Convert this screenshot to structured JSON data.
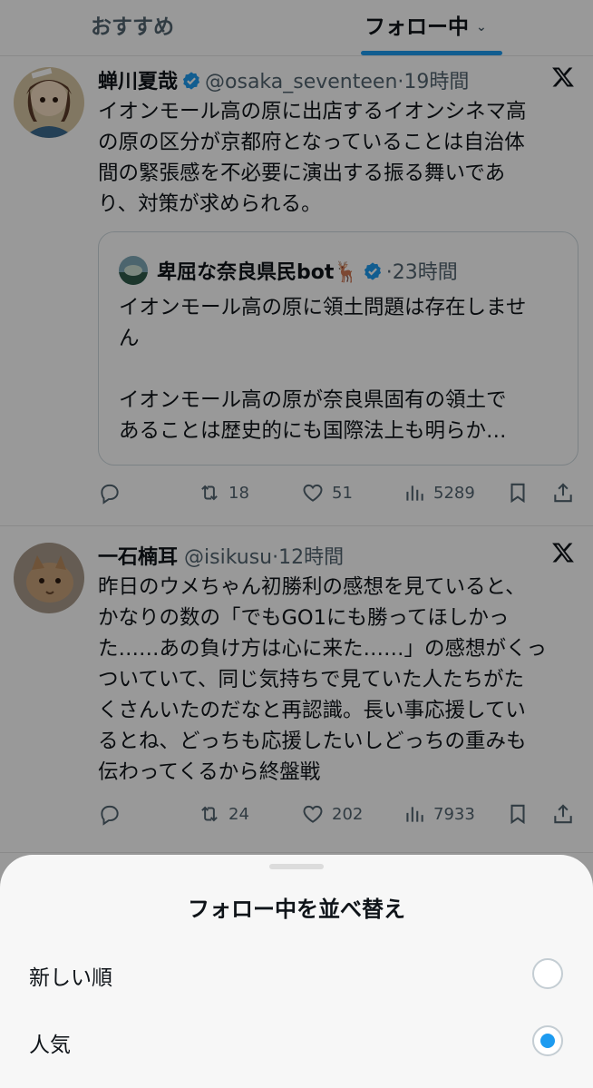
{
  "tabs": {
    "recommended": "おすすめ",
    "following": "フォロー中"
  },
  "posts": [
    {
      "name": "蝉川夏哉",
      "handle": "@osaka_seventeen",
      "time": "19時間",
      "text": "イオンモール高の原に出店するイオンシネマ高\nの原の区分が京都府となっていることは自治体\n間の緊張感を不必要に演出する振る舞いであ\nり、対策が求められる。",
      "quote": {
        "name": "卑屈な奈良県民bot🦌",
        "time": "23時間",
        "text": "イオンモール高の原に領土問題は存在しませ\nん\n\nイオンモール高の原が奈良県固有の領土で\nあることは歴史的にも国際法上も明らか…"
      },
      "stats": {
        "retweets": "18",
        "likes": "51",
        "views": "5289"
      }
    },
    {
      "name": "一石楠耳",
      "handle": "@isikusu",
      "time": "12時間",
      "text": "昨日のウメちゃん初勝利の感想を見ていると、\nかなりの数の「でもGO1にも勝ってほしかっ\nた……あの負け方は心に来た……」の感想がくっ\nついていて、同じ気持ちで見ていた人たちがた\nくさんいたのだなと再認識。長い事応援してい\nるとね、どっちも応援したいしどっちの重みも\n伝わってくるから終盤戦",
      "stats": {
        "retweets": "24",
        "likes": "202",
        "views": "7933"
      }
    }
  ],
  "sheet": {
    "title": "フォロー中を並べ替え",
    "options": [
      {
        "label": "新しい順",
        "selected": false
      },
      {
        "label": "人気",
        "selected": true
      }
    ]
  },
  "colors": {
    "accent": "#1d9bf0",
    "text": "#0f1419",
    "muted": "#536471"
  }
}
